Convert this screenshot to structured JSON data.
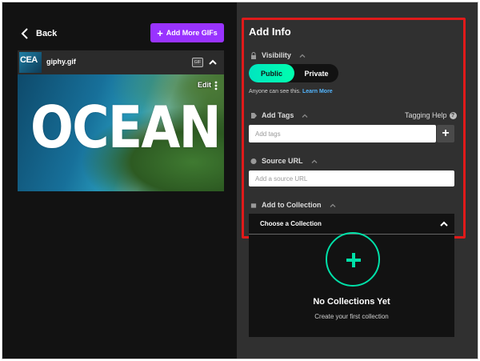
{
  "left": {
    "back_label": "Back",
    "add_gifs_label": "Add More GIFs",
    "gif": {
      "thumb_text": "CEA",
      "filename": "giphy.gif",
      "badge": "GIF",
      "edit_label": "Edit",
      "image_text": "OCEAN"
    }
  },
  "right": {
    "title": "Add Info",
    "visibility": {
      "label": "Visibility",
      "public": "Public",
      "private": "Private",
      "hint": "Anyone can see this.",
      "learn_more": "Learn More"
    },
    "tags": {
      "label": "Add Tags",
      "help_label": "Tagging Help",
      "placeholder": "Add tags"
    },
    "source": {
      "label": "Source URL",
      "placeholder": "Add a source URL"
    },
    "collection": {
      "label": "Add to Collection",
      "select_value": "Choose a Collection",
      "empty_title": "No Collections Yet",
      "empty_sub": "Create your first collection"
    }
  },
  "colors": {
    "accent_purple": "#9933ff",
    "accent_green": "#00e5c0",
    "highlight_red": "#e01a1a",
    "link_blue": "#53b6ff"
  }
}
